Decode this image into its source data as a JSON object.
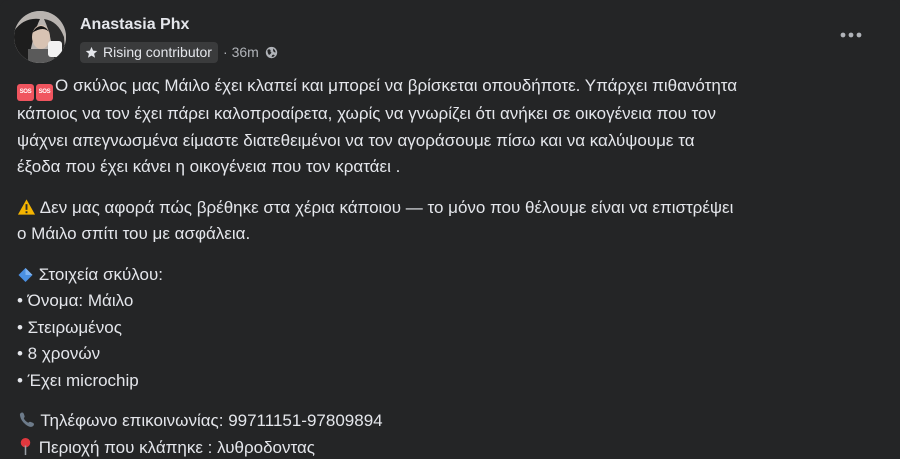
{
  "post": {
    "author": "Anastasia Phx",
    "badge_label": "Rising contributor",
    "separator": "·",
    "time": "36m",
    "audience_icon": "globe-icon",
    "more_icon": "ellipsis-icon",
    "sos_emoji": "SOS",
    "body": {
      "p1_line1": "Ο σκύλος μας Μάιλο έχει κλαπεί και μπορεί να βρίσκεται οπουδήποτε. Υπάρχει πιθανότητα",
      "p1_line2": "κάποιος να τον έχει πάρει καλοπροαίρετα, χωρίς να γνωρίζει ότι ανήκει σε οικογένεια που τον",
      "p1_line3": "ψάχνει απεγνωσμένα είμαστε διατεθειμένοι να τον αγοράσουμε πίσω και να καλύψουμε τα",
      "p1_line4": "έξοδα που έχει κάνει η οικογένεια που τον κρατάει .",
      "p2_line1": "Δεν μας αφορά πώς βρέθηκε στα χέρια κάποιου — το μόνο που θέλουμε είναι να επιστρέψει",
      "p2_line2": "ο Μάιλο σπίτι του με ασφάλεια.",
      "details_heading": "Στοιχεία σκύλου:",
      "details": [
        "• Όνομα: Μάιλο",
        "• Στειρωμένος",
        "• 8 χρονών",
        "• Έχει microchip"
      ],
      "phone_line": "Τηλέφωνο επικοινωνίας: 99711151-97809894",
      "location_line": "Περιοχή που κλάπηκε : λυθροδοντας"
    }
  },
  "colors": {
    "background": "#242526",
    "text": "#e4e6eb",
    "secondary_text": "#b0b3b8",
    "badge_bg": "#3a3b3c",
    "sos": "#f0555f"
  }
}
